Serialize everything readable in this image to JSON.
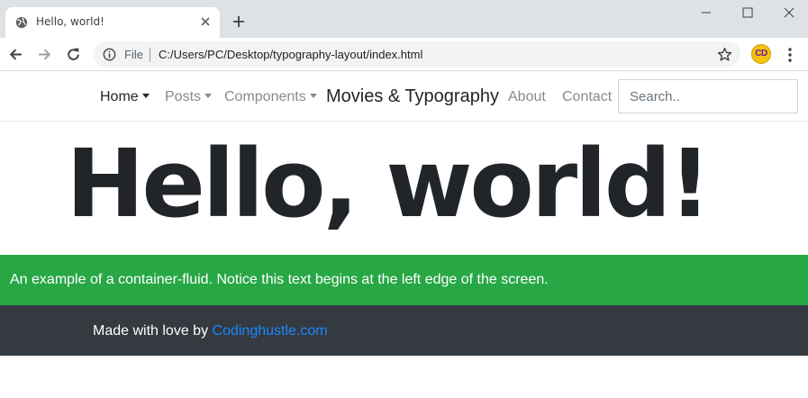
{
  "browser": {
    "tab_title": "Hello, world!",
    "address_scheme": "File",
    "address_url": "C:/Users/PC/Desktop/typography-layout/index.html",
    "profile_initials": "CD",
    "icons": [
      "globe-icon",
      "close-icon",
      "plus-icon",
      "minimize-icon",
      "maximize-icon",
      "window-close-icon",
      "back-arrow-icon",
      "forward-arrow-icon",
      "reload-icon",
      "info-icon",
      "star-icon",
      "kebab-menu-icon"
    ]
  },
  "navbar": {
    "home": "Home",
    "posts": "Posts",
    "components": "Components",
    "brand": "Movies & Typography",
    "about": "About",
    "contact": "Contact",
    "search_placeholder": "Search.."
  },
  "hero": {
    "heading": "Hello, world!"
  },
  "banner": {
    "text": "An example of a container-fluid. Notice this text begins at the left edge of the screen."
  },
  "footer": {
    "prefix": "Made with love by",
    "link_text": "Codinghustle.com"
  },
  "colors": {
    "banner_green": "#28a745",
    "footer_dark": "#343a40",
    "link_blue": "#1e87ff",
    "heading_dark": "#212529"
  }
}
